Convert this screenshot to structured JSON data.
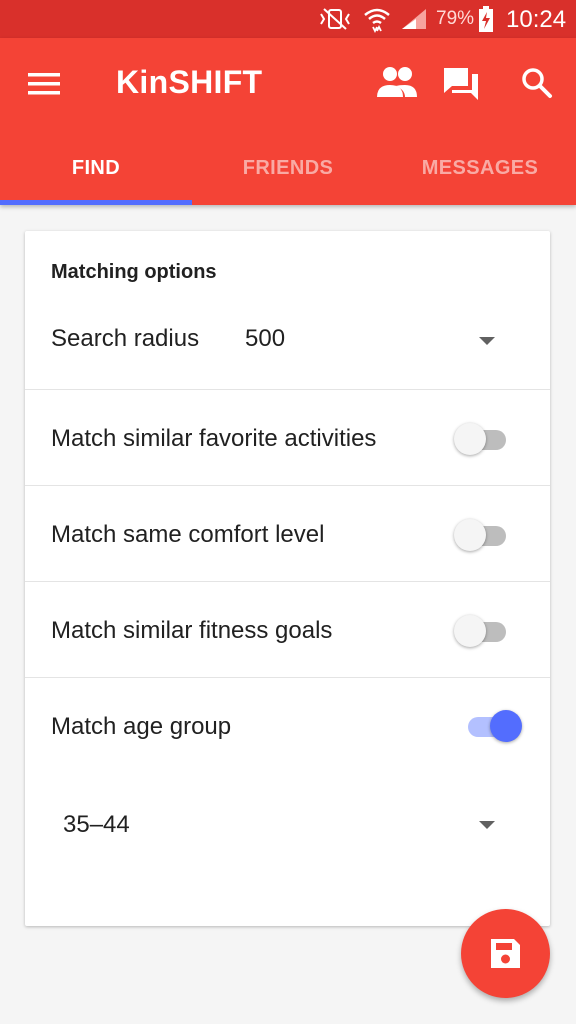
{
  "status_bar": {
    "battery_percent": "79%",
    "time": "10:24",
    "icons": [
      "mute-vibrate-icon",
      "wifi-icon",
      "signal-icon",
      "battery-charging-icon"
    ]
  },
  "app_bar": {
    "title": "KinSHIFT",
    "background_color": "#f44336",
    "actions": [
      "people-icon",
      "chat-icon",
      "search-icon"
    ]
  },
  "tabs": [
    {
      "label": "FIND",
      "active": true
    },
    {
      "label": "FRIENDS",
      "active": false
    },
    {
      "label": "MESSAGES",
      "active": false
    }
  ],
  "accent_color": "#536dfe",
  "card": {
    "section_title": "Matching options",
    "search_radius": {
      "label": "Search radius",
      "value": "500"
    },
    "toggles": [
      {
        "label": "Match similar favorite activities",
        "on": false
      },
      {
        "label": "Match same comfort level",
        "on": false
      },
      {
        "label": "Match similar fitness goals",
        "on": false
      },
      {
        "label": "Match age group",
        "on": true
      }
    ],
    "age_group": {
      "value": "35–44"
    }
  },
  "fab": {
    "icon": "save-icon"
  }
}
